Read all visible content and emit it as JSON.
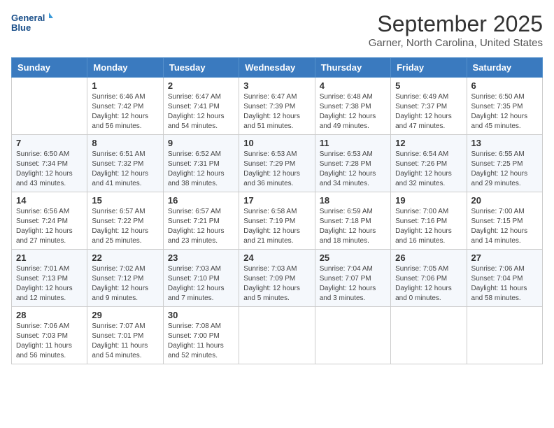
{
  "header": {
    "logo_line1": "General",
    "logo_line2": "Blue",
    "month": "September 2025",
    "location": "Garner, North Carolina, United States"
  },
  "weekdays": [
    "Sunday",
    "Monday",
    "Tuesday",
    "Wednesday",
    "Thursday",
    "Friday",
    "Saturday"
  ],
  "weeks": [
    [
      {
        "day": "",
        "content": ""
      },
      {
        "day": "1",
        "content": "Sunrise: 6:46 AM\nSunset: 7:42 PM\nDaylight: 12 hours\nand 56 minutes."
      },
      {
        "day": "2",
        "content": "Sunrise: 6:47 AM\nSunset: 7:41 PM\nDaylight: 12 hours\nand 54 minutes."
      },
      {
        "day": "3",
        "content": "Sunrise: 6:47 AM\nSunset: 7:39 PM\nDaylight: 12 hours\nand 51 minutes."
      },
      {
        "day": "4",
        "content": "Sunrise: 6:48 AM\nSunset: 7:38 PM\nDaylight: 12 hours\nand 49 minutes."
      },
      {
        "day": "5",
        "content": "Sunrise: 6:49 AM\nSunset: 7:37 PM\nDaylight: 12 hours\nand 47 minutes."
      },
      {
        "day": "6",
        "content": "Sunrise: 6:50 AM\nSunset: 7:35 PM\nDaylight: 12 hours\nand 45 minutes."
      }
    ],
    [
      {
        "day": "7",
        "content": "Sunrise: 6:50 AM\nSunset: 7:34 PM\nDaylight: 12 hours\nand 43 minutes."
      },
      {
        "day": "8",
        "content": "Sunrise: 6:51 AM\nSunset: 7:32 PM\nDaylight: 12 hours\nand 41 minutes."
      },
      {
        "day": "9",
        "content": "Sunrise: 6:52 AM\nSunset: 7:31 PM\nDaylight: 12 hours\nand 38 minutes."
      },
      {
        "day": "10",
        "content": "Sunrise: 6:53 AM\nSunset: 7:29 PM\nDaylight: 12 hours\nand 36 minutes."
      },
      {
        "day": "11",
        "content": "Sunrise: 6:53 AM\nSunset: 7:28 PM\nDaylight: 12 hours\nand 34 minutes."
      },
      {
        "day": "12",
        "content": "Sunrise: 6:54 AM\nSunset: 7:26 PM\nDaylight: 12 hours\nand 32 minutes."
      },
      {
        "day": "13",
        "content": "Sunrise: 6:55 AM\nSunset: 7:25 PM\nDaylight: 12 hours\nand 29 minutes."
      }
    ],
    [
      {
        "day": "14",
        "content": "Sunrise: 6:56 AM\nSunset: 7:24 PM\nDaylight: 12 hours\nand 27 minutes."
      },
      {
        "day": "15",
        "content": "Sunrise: 6:57 AM\nSunset: 7:22 PM\nDaylight: 12 hours\nand 25 minutes."
      },
      {
        "day": "16",
        "content": "Sunrise: 6:57 AM\nSunset: 7:21 PM\nDaylight: 12 hours\nand 23 minutes."
      },
      {
        "day": "17",
        "content": "Sunrise: 6:58 AM\nSunset: 7:19 PM\nDaylight: 12 hours\nand 21 minutes."
      },
      {
        "day": "18",
        "content": "Sunrise: 6:59 AM\nSunset: 7:18 PM\nDaylight: 12 hours\nand 18 minutes."
      },
      {
        "day": "19",
        "content": "Sunrise: 7:00 AM\nSunset: 7:16 PM\nDaylight: 12 hours\nand 16 minutes."
      },
      {
        "day": "20",
        "content": "Sunrise: 7:00 AM\nSunset: 7:15 PM\nDaylight: 12 hours\nand 14 minutes."
      }
    ],
    [
      {
        "day": "21",
        "content": "Sunrise: 7:01 AM\nSunset: 7:13 PM\nDaylight: 12 hours\nand 12 minutes."
      },
      {
        "day": "22",
        "content": "Sunrise: 7:02 AM\nSunset: 7:12 PM\nDaylight: 12 hours\nand 9 minutes."
      },
      {
        "day": "23",
        "content": "Sunrise: 7:03 AM\nSunset: 7:10 PM\nDaylight: 12 hours\nand 7 minutes."
      },
      {
        "day": "24",
        "content": "Sunrise: 7:03 AM\nSunset: 7:09 PM\nDaylight: 12 hours\nand 5 minutes."
      },
      {
        "day": "25",
        "content": "Sunrise: 7:04 AM\nSunset: 7:07 PM\nDaylight: 12 hours\nand 3 minutes."
      },
      {
        "day": "26",
        "content": "Sunrise: 7:05 AM\nSunset: 7:06 PM\nDaylight: 12 hours\nand 0 minutes."
      },
      {
        "day": "27",
        "content": "Sunrise: 7:06 AM\nSunset: 7:04 PM\nDaylight: 11 hours\nand 58 minutes."
      }
    ],
    [
      {
        "day": "28",
        "content": "Sunrise: 7:06 AM\nSunset: 7:03 PM\nDaylight: 11 hours\nand 56 minutes."
      },
      {
        "day": "29",
        "content": "Sunrise: 7:07 AM\nSunset: 7:01 PM\nDaylight: 11 hours\nand 54 minutes."
      },
      {
        "day": "30",
        "content": "Sunrise: 7:08 AM\nSunset: 7:00 PM\nDaylight: 11 hours\nand 52 minutes."
      },
      {
        "day": "",
        "content": ""
      },
      {
        "day": "",
        "content": ""
      },
      {
        "day": "",
        "content": ""
      },
      {
        "day": "",
        "content": ""
      }
    ]
  ]
}
